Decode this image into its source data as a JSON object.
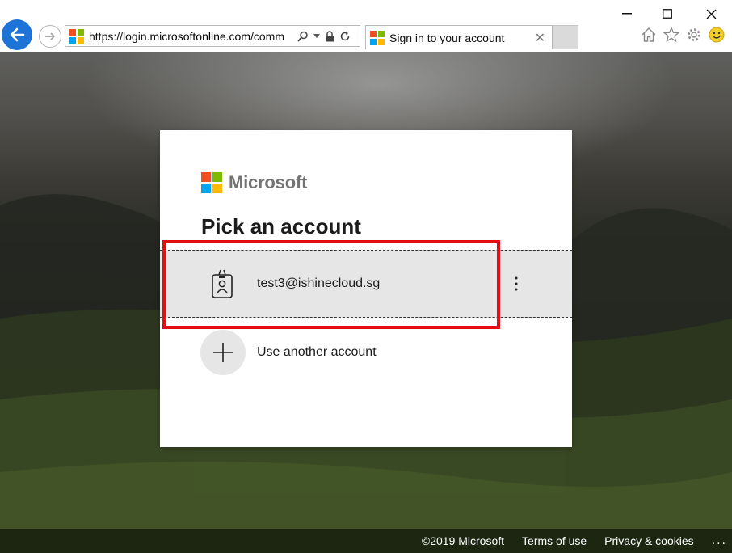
{
  "browser": {
    "address_url_prefix": "https://login.",
    "address_url_host": "microsoftonline.com",
    "address_url_rest": "/comm",
    "tab_title": "Sign in to your account"
  },
  "card": {
    "brand": "Microsoft",
    "title": "Pick an account",
    "account_email": "test3@ishinecloud.sg",
    "use_another": "Use another account"
  },
  "footer": {
    "copyright": "©2019 Microsoft",
    "terms": "Terms of use",
    "privacy": "Privacy & cookies",
    "more": "..."
  },
  "colors": {
    "back_button": "#1e73d6",
    "ms_red": "#f25022",
    "ms_green": "#7fba00",
    "ms_blue": "#00a4ef",
    "ms_yellow": "#ffb900",
    "highlight_box": "#e40d12"
  }
}
